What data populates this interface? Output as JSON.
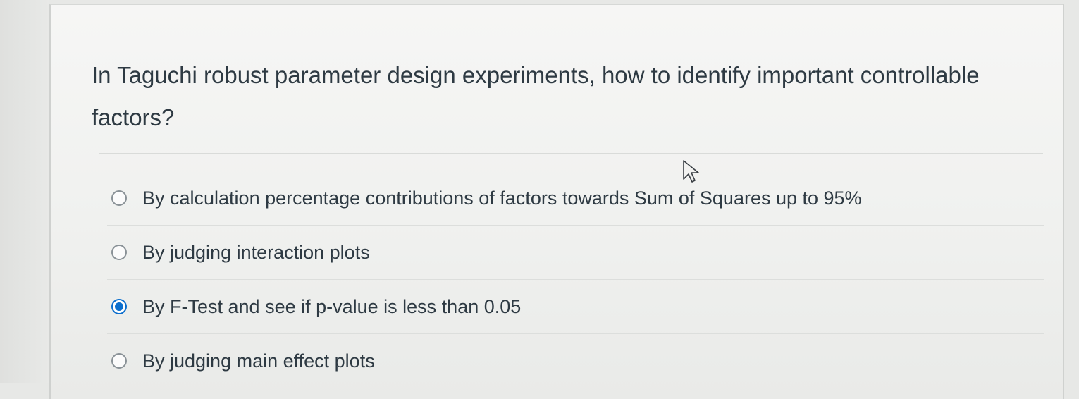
{
  "question": {
    "text": "In Taguchi robust parameter design experiments, how to identify important controllable factors?"
  },
  "answers": [
    {
      "label": "By calculation percentage contributions of factors towards Sum of Squares up to 95%",
      "selected": false
    },
    {
      "label": "By judging interaction plots",
      "selected": false
    },
    {
      "label": "By F-Test and see if p-value is less than 0.05",
      "selected": true
    },
    {
      "label": "By judging main effect plots",
      "selected": false
    }
  ],
  "colors": {
    "accent": "#0b6ecd",
    "text": "#2e3a43"
  },
  "icons": {
    "pointer": "mouse-pointer-icon"
  }
}
